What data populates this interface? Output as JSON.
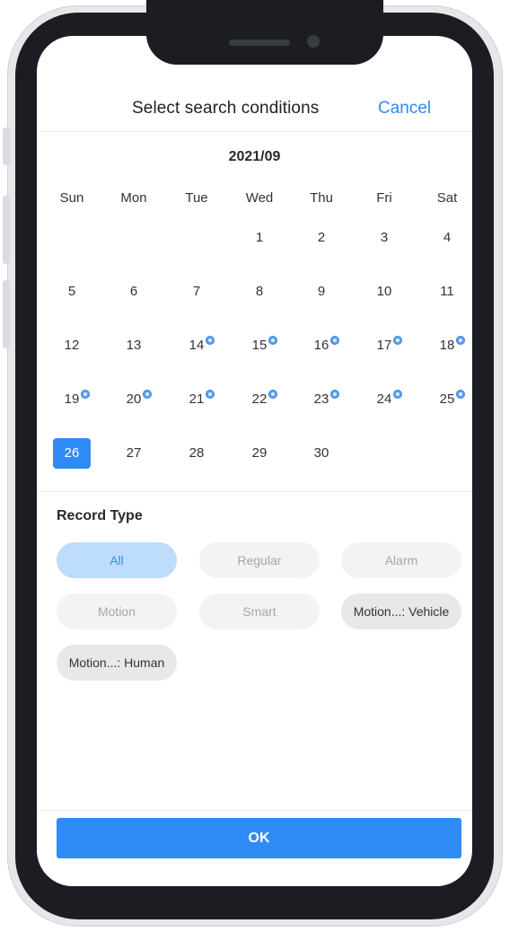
{
  "header": {
    "title": "Select search conditions",
    "cancel_label": "Cancel"
  },
  "calendar": {
    "month_label": "2021/09",
    "weekdays": [
      "Sun",
      "Mon",
      "Tue",
      "Wed",
      "Thu",
      "Fri",
      "Sat"
    ],
    "days": [
      "1",
      "2",
      "3",
      "4",
      "5",
      "6",
      "7",
      "8",
      "9",
      "10",
      "11",
      "12",
      "13",
      "14",
      "15",
      "16",
      "17",
      "18",
      "19",
      "20",
      "21",
      "22",
      "23",
      "24",
      "25",
      "26",
      "27",
      "28",
      "29",
      "30"
    ],
    "selected_day": "26",
    "days_with_recordings": [
      "14",
      "15",
      "16",
      "17",
      "18",
      "19",
      "20",
      "21",
      "22",
      "23",
      "24",
      "25"
    ]
  },
  "record_type": {
    "label": "Record Type",
    "options": [
      "All",
      "Regular",
      "Alarm",
      "Motion",
      "Smart",
      "Motion...: Vehicle",
      "Motion...: Human"
    ],
    "selected": "All"
  },
  "footer": {
    "ok_label": "OK"
  },
  "colors": {
    "accent": "#2f8cf7",
    "chip_active_bg": "#bedcfb"
  }
}
